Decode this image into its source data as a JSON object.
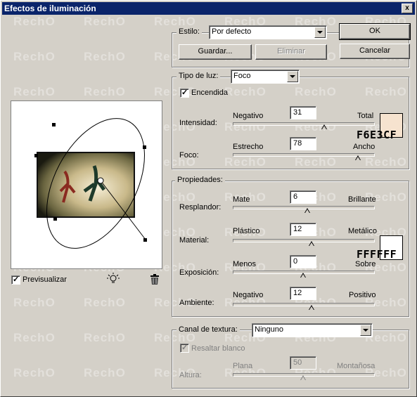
{
  "window": {
    "title": "Efectos de iluminación",
    "close_label": "x"
  },
  "watermark": "RechO",
  "style": {
    "label": "Estilo:",
    "value": "Por defecto",
    "save_label": "Guardar...",
    "delete_label": "Eliminar"
  },
  "buttons": {
    "ok": "OK",
    "cancel": "Cancelar"
  },
  "light_type": {
    "legend_label": "Tipo de luz:",
    "value": "Foco",
    "on_label": "Encendida",
    "on_checked": true,
    "intensity": {
      "label": "Intensidad:",
      "min_label": "Negativo",
      "max_label": "Total",
      "value": "31",
      "level": 0.65
    },
    "focus": {
      "label": "Foco:",
      "min_label": "Estrecho",
      "max_label": "Ancho",
      "value": "78",
      "level": 0.89
    },
    "color": "#F6E3CF",
    "color_hex": "F6E3CF"
  },
  "properties": {
    "legend": "Propiedades:",
    "gloss": {
      "label": "Resplandor:",
      "min_label": "Mate",
      "max_label": "Brillante",
      "value": "6",
      "level": 0.53
    },
    "material": {
      "label": "Material:",
      "min_label": "Plástico",
      "max_label": "Metálico",
      "value": "12",
      "level": 0.56
    },
    "exposure": {
      "label": "Exposición:",
      "min_label": "Menos",
      "max_label": "Sobre",
      "value": "0",
      "level": 0.5
    },
    "ambience": {
      "label": "Ambiente:",
      "min_label": "Negativo",
      "max_label": "Positivo",
      "value": "12",
      "level": 0.56
    },
    "color": "#FFFFFF",
    "color_hex": "FFFFFF"
  },
  "texture": {
    "legend_label": "Canal de textura:",
    "value": "Ninguno",
    "white_high_label": "Resaltar blanco",
    "white_high_checked": true,
    "height": {
      "label": "Altura:",
      "min_label": "Plana",
      "max_label": "Montañosa",
      "value": "50",
      "level": 0.5
    }
  },
  "preview": {
    "label": "Previsualizar",
    "checked": true
  }
}
